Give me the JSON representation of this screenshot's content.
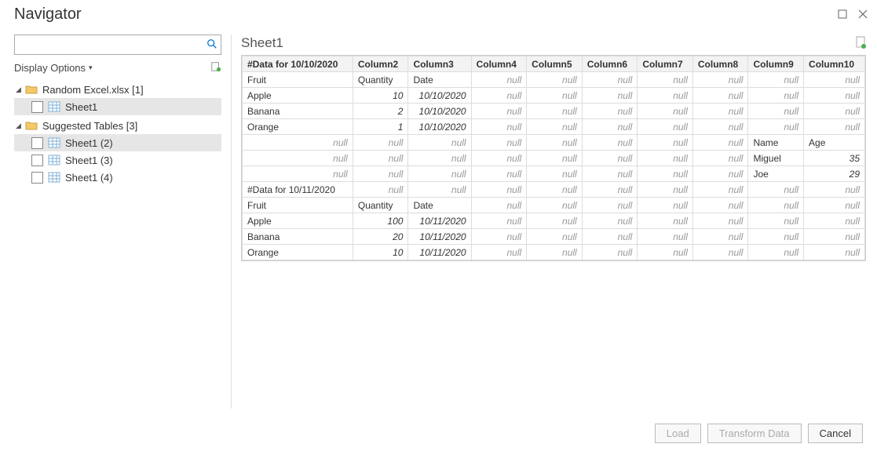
{
  "window": {
    "title": "Navigator"
  },
  "sidebar": {
    "search_placeholder": "",
    "display_options_label": "Display Options",
    "file_group": {
      "label": "Random Excel.xlsx [1]",
      "items": [
        {
          "label": "Sheet1",
          "selected": true
        }
      ]
    },
    "suggested_group": {
      "label": "Suggested Tables [3]",
      "items": [
        {
          "label": "Sheet1 (2)",
          "selected": true
        },
        {
          "label": "Sheet1 (3)",
          "selected": false
        },
        {
          "label": "Sheet1 (4)",
          "selected": false
        }
      ]
    }
  },
  "preview": {
    "title": "Sheet1",
    "columns": [
      "#Data for 10/10/2020",
      "Column2",
      "Column3",
      "Column4",
      "Column5",
      "Column6",
      "Column7",
      "Column8",
      "Column9",
      "Column10"
    ],
    "rows": [
      [
        "Fruit",
        "Quantity",
        "Date",
        null,
        null,
        null,
        null,
        null,
        null,
        null
      ],
      [
        "Apple",
        10,
        "10/10/2020",
        null,
        null,
        null,
        null,
        null,
        null,
        null
      ],
      [
        "Banana",
        2,
        "10/10/2020",
        null,
        null,
        null,
        null,
        null,
        null,
        null
      ],
      [
        "Orange",
        1,
        "10/10/2020",
        null,
        null,
        null,
        null,
        null,
        null,
        null
      ],
      [
        null,
        null,
        null,
        null,
        null,
        null,
        null,
        null,
        "Name",
        "Age"
      ],
      [
        null,
        null,
        null,
        null,
        null,
        null,
        null,
        null,
        "Miguel",
        35
      ],
      [
        null,
        null,
        null,
        null,
        null,
        null,
        null,
        null,
        "Joe",
        29
      ],
      [
        "#Data for 10/11/2020",
        null,
        null,
        null,
        null,
        null,
        null,
        null,
        null,
        null
      ],
      [
        "Fruit",
        "Quantity",
        "Date",
        null,
        null,
        null,
        null,
        null,
        null,
        null
      ],
      [
        "Apple",
        100,
        "10/11/2020",
        null,
        null,
        null,
        null,
        null,
        null,
        null
      ],
      [
        "Banana",
        20,
        "10/11/2020",
        null,
        null,
        null,
        null,
        null,
        null,
        null
      ],
      [
        "Orange",
        10,
        "10/11/2020",
        null,
        null,
        null,
        null,
        null,
        null,
        null
      ]
    ]
  },
  "footer": {
    "load_label": "Load",
    "transform_label": "Transform Data",
    "cancel_label": "Cancel"
  }
}
